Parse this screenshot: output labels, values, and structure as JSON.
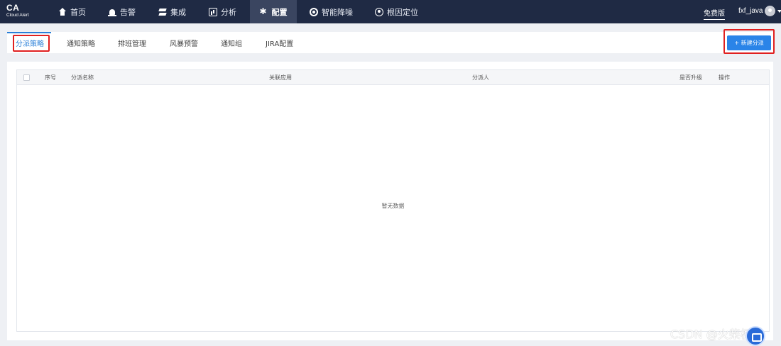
{
  "app": {
    "logo_main": "CA",
    "logo_sub": "Cloud Alert"
  },
  "nav": {
    "items": [
      {
        "label": "首页",
        "icon": "home-icon"
      },
      {
        "label": "告警",
        "icon": "alarm-icon"
      },
      {
        "label": "集成",
        "icon": "layers-icon"
      },
      {
        "label": "分析",
        "icon": "chart-icon"
      },
      {
        "label": "配置",
        "icon": "gear-icon",
        "active": true
      },
      {
        "label": "智能降噪",
        "icon": "noise-reduction-icon"
      },
      {
        "label": "根因定位",
        "icon": "target-icon"
      }
    ],
    "plan_label": "免费版",
    "username": "fxf_java"
  },
  "tabs": {
    "items": [
      {
        "label": "分派策略",
        "active": true
      },
      {
        "label": "通知策略"
      },
      {
        "label": "排班管理"
      },
      {
        "label": "风暴预警"
      },
      {
        "label": "通知组"
      },
      {
        "label": "JIRA配置"
      }
    ],
    "new_button_label": "+ 新建分派"
  },
  "table": {
    "columns": [
      "序号",
      "分派名称",
      "关联应用",
      "分派人",
      "是否升级",
      "操作"
    ],
    "rows": [],
    "empty_text": "暂无数据"
  },
  "watermark": "CSDN @火柴梗i",
  "colors": {
    "topbar": "#1f2a44",
    "accent": "#2a84e8",
    "highlight": "#e02020"
  }
}
